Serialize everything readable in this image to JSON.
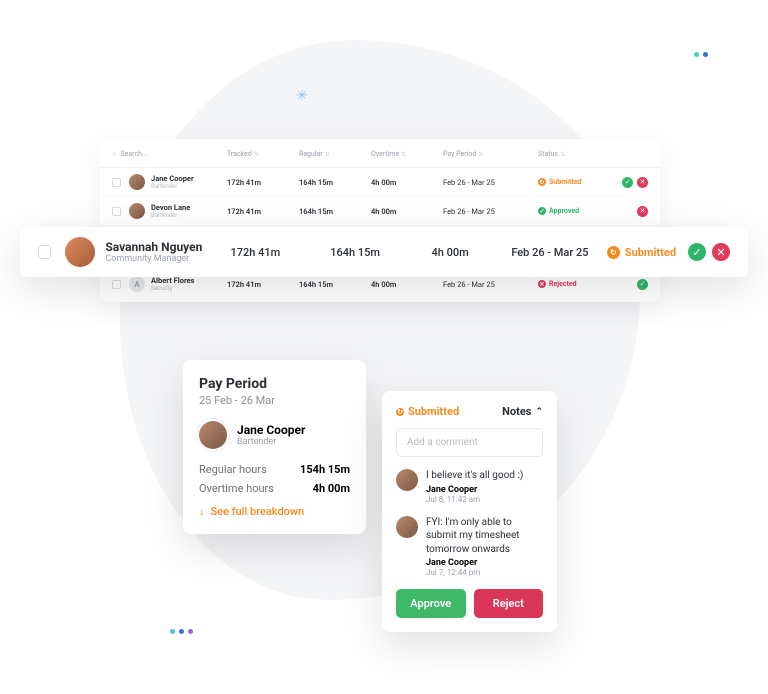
{
  "table": {
    "search_placeholder": "Search...",
    "columns": {
      "tracked": "Tracked",
      "regular": "Regular",
      "overtime": "Overtime",
      "pay_period": "Pay Period",
      "status": "Status"
    },
    "rows": [
      {
        "name": "Jane Cooper",
        "role": "Bartender",
        "tracked": "172h 41m",
        "regular": "164h 15m",
        "overtime": "4h 00m",
        "period": "Feb 26 - Mar 25",
        "status": "Submitted"
      },
      {
        "name": "Devon Lane",
        "role": "Bartender",
        "tracked": "172h 41m",
        "regular": "164h 15m",
        "overtime": "4h 00m",
        "period": "Feb 26 - Mar 25",
        "status": "Approved"
      },
      {
        "name": "Albert Flores",
        "role": "Security",
        "tracked": "172h 41m",
        "regular": "164h 15m",
        "overtime": "4h 00m",
        "period": "Feb 26 - Mar 25",
        "status": "Rejected"
      }
    ]
  },
  "highlight": {
    "name": "Savannah Nguyen",
    "role": "Community Manager",
    "tracked": "172h 41m",
    "regular": "164h 15m",
    "overtime": "4h 00m",
    "period": "Feb 26 - Mar 25",
    "status": "Submitted"
  },
  "pay_card": {
    "title": "Pay Period",
    "range": "25 Feb - 26 Mar",
    "employee_name": "Jane Cooper",
    "employee_role": "Bartender",
    "regular_label": "Regular hours",
    "regular_value": "154h 15m",
    "overtime_label": "Overtime hours",
    "overtime_value": "4h 00m",
    "breakdown_link": "See full breakdown"
  },
  "notes_card": {
    "status": "Submitted",
    "tab": "Notes",
    "input_placeholder": "Add a comment",
    "notes": [
      {
        "msg": "I believe it's all good :)",
        "by": "Jane Cooper",
        "ts": "Jul 8, 11:42 am"
      },
      {
        "msg": "FYI: I'm only able to submit my timesheet tomorrow onwards",
        "by": "Jane Cooper",
        "ts": "Jul 7, 12:44 pm"
      }
    ],
    "approve": "Approve",
    "reject": "Reject"
  }
}
